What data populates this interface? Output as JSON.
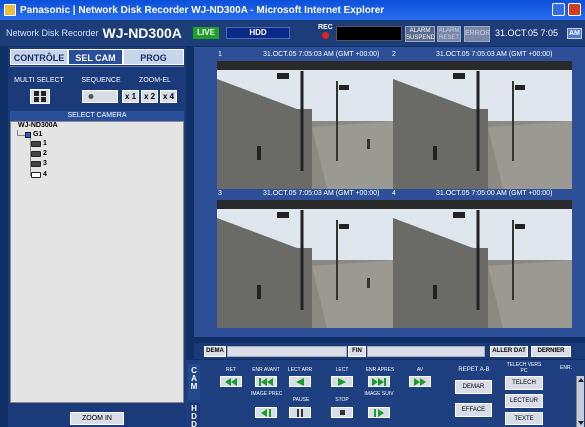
{
  "window": {
    "title": "Panasonic | Network Disk Recorder WJ-ND300A - Microsoft Internet Explorer"
  },
  "header": {
    "product_small": "Network Disk Recorder",
    "product_model": "WJ-ND300A",
    "live_label": "LIVE",
    "hdd_label": "HDD",
    "rec_label": "REC",
    "alarm_suspend": "ALARM SUSPEND",
    "alarm_reset": "ALARM RESET",
    "error_label": "ERROR",
    "datetime": "31.OCT.05   7:05",
    "ampm": "AM"
  },
  "tabs": [
    {
      "label": "CONTRÔLE"
    },
    {
      "label": "SEL CAM"
    },
    {
      "label": "PROG"
    }
  ],
  "select_controls": {
    "multi_select": "MULTI SELECT",
    "sequence": "SEQUENCE",
    "zoom_el": "ZOOM-EL",
    "zoom_x1": "x 1",
    "zoom_x2": "x 2",
    "zoom_x4": "x 4"
  },
  "camera_tree": {
    "header": "SELECT CAMERA",
    "root": "WJ-ND300A",
    "group": "G1",
    "cameras": [
      "1",
      "2",
      "3",
      "4"
    ]
  },
  "zoom_in": "ZOOM IN",
  "video": [
    {
      "num": "1",
      "timestamp": "31.OCT.05   7:05:03 AM (GMT +00:00)"
    },
    {
      "num": "2",
      "timestamp": "31.OCT.05   7:05:03 AM (GMT +00:00)"
    },
    {
      "num": "3",
      "timestamp": "31.OCT.05   7:05:03 AM (GMT +00:00)"
    },
    {
      "num": "4",
      "timestamp": "31.OCT.05   7:05:00 AM (GMT +00:00)"
    }
  ],
  "transport": {
    "start": "DEMA",
    "end": "FIN",
    "goto_date": "ALLER DAT",
    "last": "DERNIER"
  },
  "side_tabs": {
    "cam": "CAM",
    "hdd": "HDD"
  },
  "playback": {
    "labels_row1": [
      "RET",
      "ENR AVANT",
      "LECT ARR",
      "LECT",
      "ENR APRES",
      "AV"
    ],
    "labels_row2": [
      "IMAGE PREC",
      "PAUSE",
      "STOP",
      "IMAGE SUIV"
    ]
  },
  "repeat_ab": {
    "label": "REPET A-B",
    "start": "DEMAR",
    "clear": "EFFACE"
  },
  "download": {
    "label": "TELECH VERS PC",
    "download": "TELECH",
    "player": "LECTEUR",
    "text": "TEXTE"
  },
  "enr_label": "ENR.",
  "colors": {
    "background": "#0f2f66",
    "panel": "#1a3a7a",
    "live": "#1fa02a",
    "play_green": "#1a9a2a",
    "rec": "#e02020"
  }
}
